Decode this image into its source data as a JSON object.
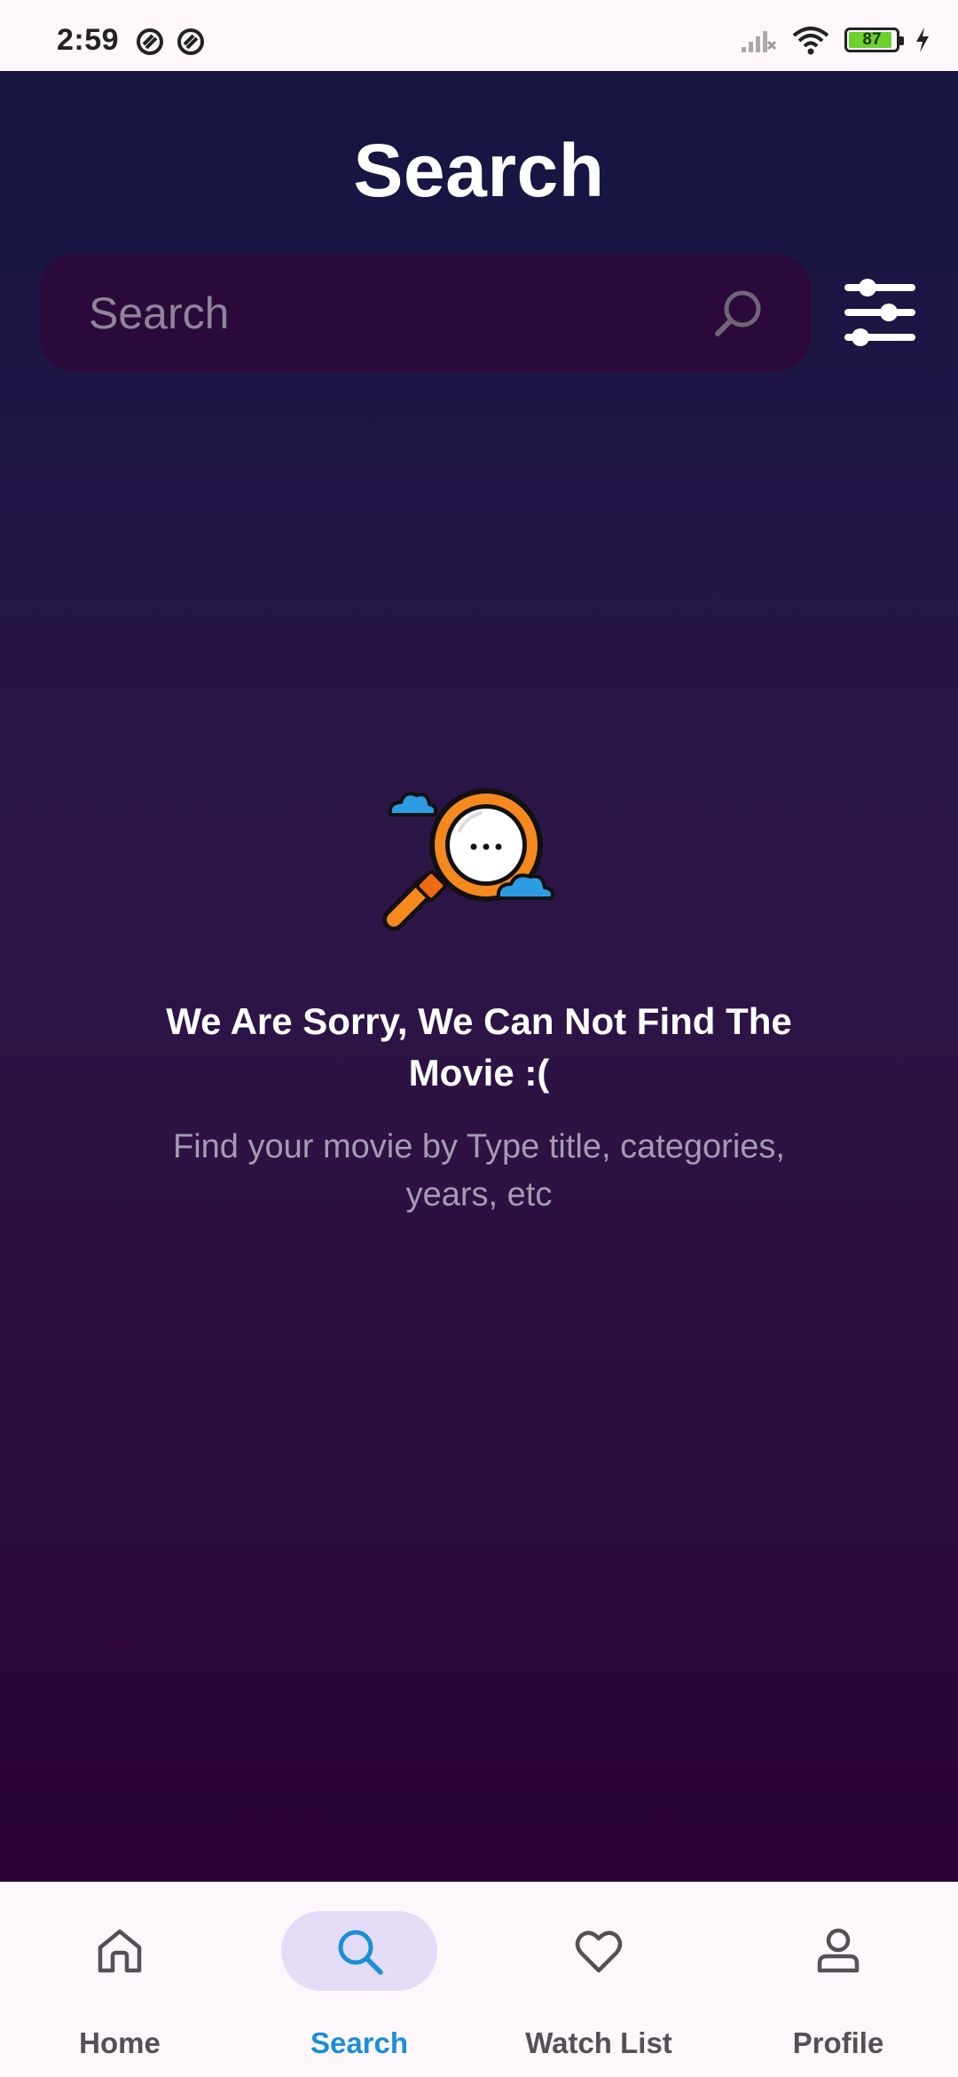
{
  "status_bar": {
    "time": "2:59",
    "battery_level": "87",
    "icons": [
      "dnd-icon",
      "dnd-icon",
      "signal-icon",
      "wifi-icon",
      "battery-icon",
      "charging-icon"
    ]
  },
  "header": {
    "title": "Search"
  },
  "search": {
    "placeholder": "Search",
    "value": "",
    "icon": "search-icon",
    "filter_icon": "sliders-icon"
  },
  "empty_state": {
    "icon": "magnifier-clouds-illustration",
    "title": "We Are Sorry, We Can Not Find The Movie :(",
    "subtitle": "Find your movie by Type title, categories, years, etc"
  },
  "bottom_nav": {
    "items": [
      {
        "label": "Home",
        "icon": "home-icon",
        "active": false
      },
      {
        "label": "Search",
        "icon": "search-icon",
        "active": true
      },
      {
        "label": "Watch List",
        "icon": "heart-icon",
        "active": false
      },
      {
        "label": "Profile",
        "icon": "user-icon",
        "active": false
      }
    ]
  },
  "colors": {
    "background_top": "#141540",
    "background_bottom": "#2a0233",
    "search_box": "#2b0a3b",
    "active_nav": "#1a8fd6",
    "active_pill": "#e4dcf6"
  }
}
